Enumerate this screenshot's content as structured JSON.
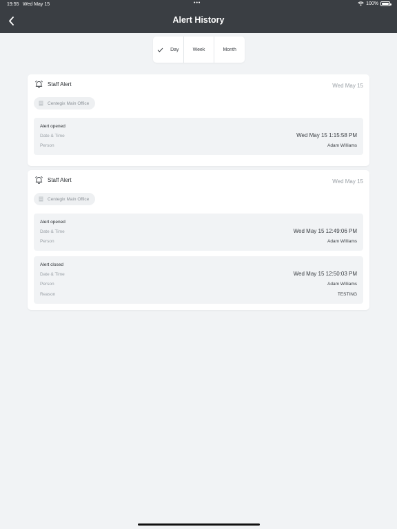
{
  "status_bar": {
    "time": "19:55",
    "date": "Wed May 15",
    "battery": "100%"
  },
  "header": {
    "title": "Alert History"
  },
  "filter": {
    "options": [
      {
        "label": "Day",
        "selected": true
      },
      {
        "label": "Week",
        "selected": false
      },
      {
        "label": "Month",
        "selected": false
      }
    ]
  },
  "alerts": [
    {
      "title": "Staff Alert",
      "date": "Wed May 15",
      "location": "Centegix Main Office",
      "events": [
        {
          "title": "Alert opened",
          "rows": [
            {
              "label": "Date & Time",
              "value": "Wed May 15 1:15:58 PM"
            },
            {
              "label": "Person",
              "value": "Adam Williams"
            }
          ]
        }
      ]
    },
    {
      "title": "Staff Alert",
      "date": "Wed May 15",
      "location": "Centegix Main Office",
      "events": [
        {
          "title": "Alert opened",
          "rows": [
            {
              "label": "Date & Time",
              "value": "Wed May 15 12:49:06 PM"
            },
            {
              "label": "Person",
              "value": "Adam Williams"
            }
          ]
        },
        {
          "title": "Alert closed",
          "rows": [
            {
              "label": "Date & Time",
              "value": "Wed May 15 12:50:03 PM"
            },
            {
              "label": "Person",
              "value": "Adam Williams"
            },
            {
              "label": "Reason",
              "value": "TESTING"
            }
          ]
        }
      ]
    }
  ]
}
